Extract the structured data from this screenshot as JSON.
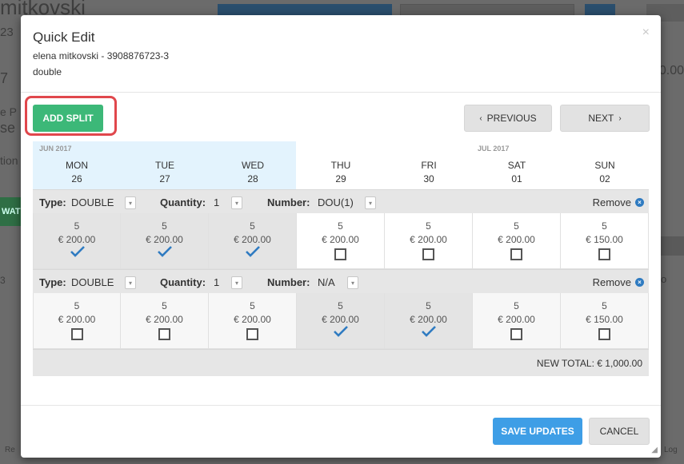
{
  "background": {
    "title_fragment": "mitkovski",
    "sub_fragment": "23",
    "seven": "7",
    "e_fragment": "e P",
    "se_fragment": "se",
    "tion_fragment": "tion",
    "wat_fragment": "WAT",
    "three_fragment": "3",
    "right_fragment": "0.00",
    "o_fragment": "o",
    "re_fragment": "Re",
    "log_fragment": "Log"
  },
  "modal": {
    "title": "Quick Edit",
    "guest": "elena mitkovski - 3908876723-3",
    "room_type": "double",
    "close": "×"
  },
  "buttons": {
    "add_split": "ADD SPLIT",
    "previous": "PREVIOUS",
    "next": "NEXT",
    "save": "SAVE UPDATES",
    "cancel": "CANCEL"
  },
  "months": {
    "jun": "JUN 2017",
    "jul": "JUL 2017"
  },
  "days": [
    {
      "dow": "MON",
      "date": "26"
    },
    {
      "dow": "TUE",
      "date": "27"
    },
    {
      "dow": "WED",
      "date": "28"
    },
    {
      "dow": "THU",
      "date": "29"
    },
    {
      "dow": "FRI",
      "date": "30"
    },
    {
      "dow": "SAT",
      "date": "01"
    },
    {
      "dow": "SUN",
      "date": "02"
    }
  ],
  "splits": [
    {
      "type_label": "Type:",
      "type_value": "DOUBLE",
      "qty_label": "Quantity:",
      "qty_value": "1",
      "num_label": "Number:",
      "num_value": "DOU(1)",
      "remove": "Remove",
      "cells": [
        {
          "qty": "5",
          "price": "€ 200.00",
          "checked": true
        },
        {
          "qty": "5",
          "price": "€ 200.00",
          "checked": true
        },
        {
          "qty": "5",
          "price": "€ 200.00",
          "checked": true
        },
        {
          "qty": "5",
          "price": "€ 200.00",
          "checked": false
        },
        {
          "qty": "5",
          "price": "€ 200.00",
          "checked": false
        },
        {
          "qty": "5",
          "price": "€ 200.00",
          "checked": false
        },
        {
          "qty": "5",
          "price": "€ 150.00",
          "checked": false
        }
      ]
    },
    {
      "type_label": "Type:",
      "type_value": "DOUBLE",
      "qty_label": "Quantity:",
      "qty_value": "1",
      "num_label": "Number:",
      "num_value": "N/A",
      "remove": "Remove",
      "cells": [
        {
          "qty": "5",
          "price": "€ 200.00",
          "checked": false
        },
        {
          "qty": "5",
          "price": "€ 200.00",
          "checked": false
        },
        {
          "qty": "5",
          "price": "€ 200.00",
          "checked": false
        },
        {
          "qty": "5",
          "price": "€ 200.00",
          "checked": true
        },
        {
          "qty": "5",
          "price": "€ 200.00",
          "checked": true
        },
        {
          "qty": "5",
          "price": "€ 200.00",
          "checked": false
        },
        {
          "qty": "5",
          "price": "€ 150.00",
          "checked": false
        }
      ]
    }
  ],
  "new_total": "NEW TOTAL: € 1,000.00",
  "colors": {
    "add_split": "#3cb878",
    "save": "#3e9ee6",
    "highlight": "#e0474c",
    "jun_header": "#e3f3fd",
    "check": "#2f7bc1"
  }
}
